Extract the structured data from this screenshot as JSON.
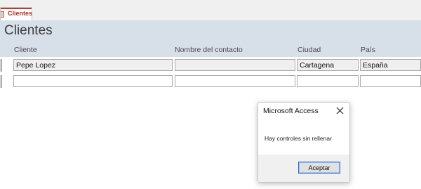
{
  "tab": {
    "label": "Clientes",
    "icon": "form-icon",
    "accent": "#c0392b"
  },
  "form": {
    "title": "Clientes",
    "columns": [
      "Cliente",
      "Nombre del contacto",
      "Ciudad",
      "País"
    ],
    "rows": [
      {
        "cliente": "Pepe Lopez",
        "contacto": "",
        "ciudad": "Cartagena",
        "pais": "España"
      },
      {
        "cliente": "",
        "contacto": "",
        "ciudad": "",
        "pais": ""
      }
    ]
  },
  "dialog": {
    "title": "Microsoft Access",
    "message": "Hay controles sin rellenar",
    "button_label": "Aceptar",
    "close_icon": "close-icon"
  },
  "colors": {
    "header_band": "#d7dfe9",
    "dialog_button_border": "#2f6fc4"
  }
}
